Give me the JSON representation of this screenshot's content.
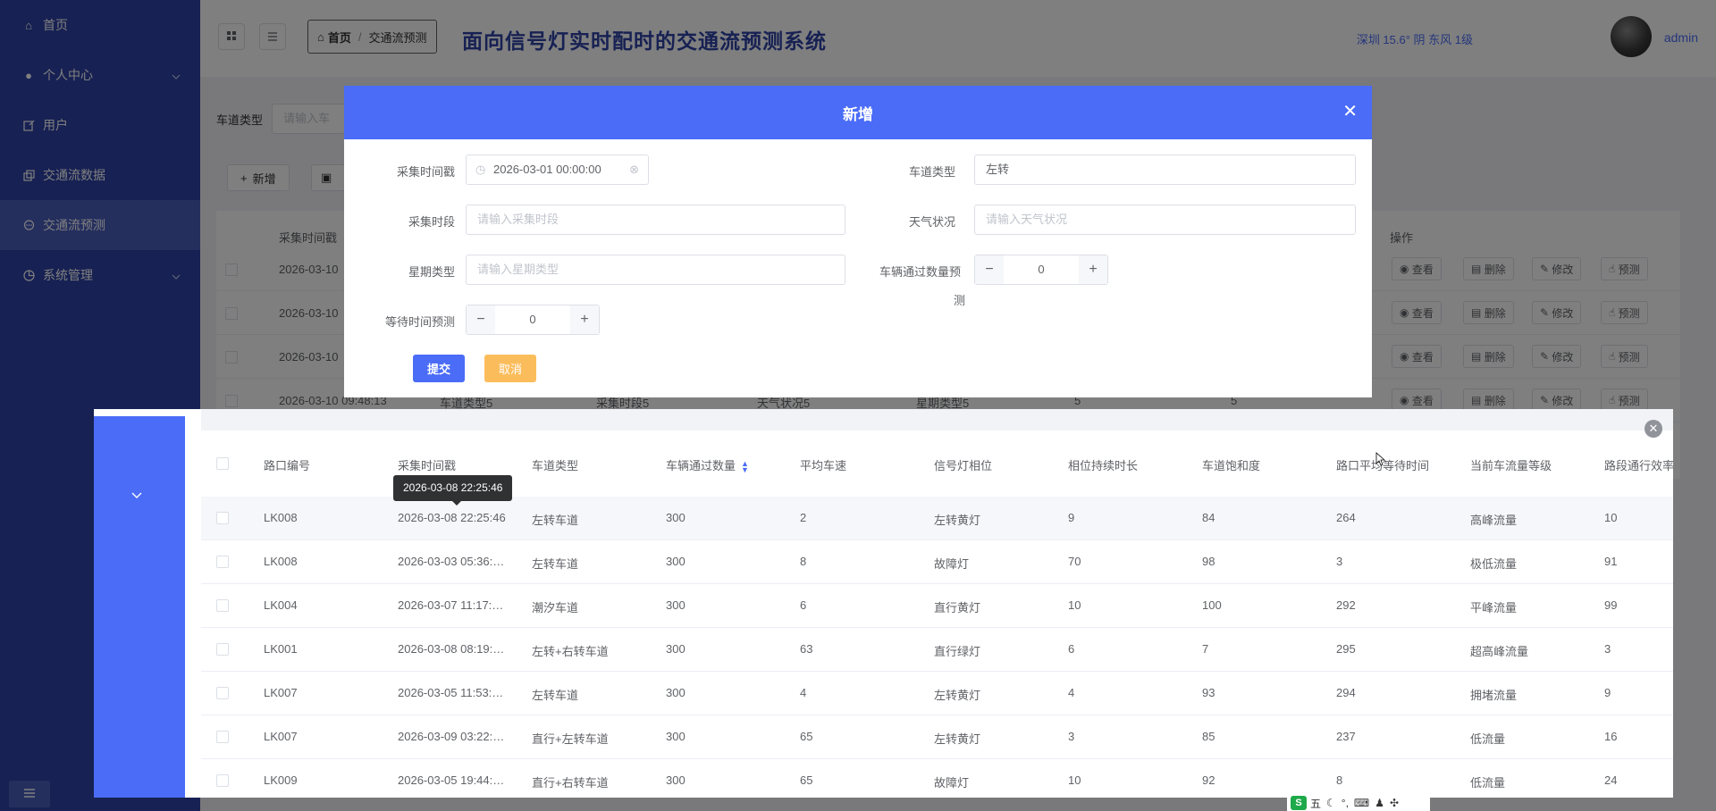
{
  "sidebar": {
    "items": [
      {
        "label": "首页",
        "icon": "home-icon"
      },
      {
        "label": "个人中心",
        "icon": "user-icon"
      },
      {
        "label": "用户",
        "icon": "edit-icon"
      },
      {
        "label": "交通流数据",
        "icon": "copy-icon"
      },
      {
        "label": "交通流预测",
        "icon": "chat-icon",
        "active": true
      },
      {
        "label": "系统管理",
        "icon": "chart-icon"
      }
    ]
  },
  "header": {
    "breadcrumb": {
      "home": "首页",
      "current": "交通流预测"
    },
    "title": "面向信号灯实时配时的交通流预测系统",
    "weather": "深圳 15.6° 阴 东风 1级",
    "user": "admin"
  },
  "main": {
    "search_label": "车道类型",
    "search_placeholder": "请输入车",
    "add_button": "新增",
    "table_headers": {
      "first": "采集时间戳",
      "ops": "操作"
    },
    "rows": [
      "2026-03-10",
      "2026-03-10",
      "2026-03-10",
      "2026-03-10 09:48:13"
    ],
    "row_partial": {
      "lane": "车道类型5",
      "period": "采集时段5",
      "weather": "天气状况5",
      "week": "星期类型5",
      "n1": "5",
      "n2": "5"
    },
    "ops": {
      "view": "查看",
      "delete": "删除",
      "edit": "修改",
      "predict": "预测"
    }
  },
  "dialog": {
    "title": "新增",
    "fields": {
      "timestamp": {
        "label": "采集时间戳",
        "value": "2026-03-01 00:00:00"
      },
      "lane_type": {
        "label": "车道类型",
        "value": "左转"
      },
      "period": {
        "label": "采集时段",
        "placeholder": "请输入采集时段"
      },
      "weather": {
        "label": "天气状况",
        "placeholder": "请输入天气状况"
      },
      "week": {
        "label": "星期类型",
        "placeholder": "请输入星期类型"
      },
      "vehicles": {
        "label_line1": "车辆通过数量预",
        "label_line2": "测",
        "value": "0"
      },
      "wait": {
        "label": "等待时间预测",
        "value": "0"
      }
    },
    "submit": "提交",
    "cancel": "取消"
  },
  "popup": {
    "headers": [
      "路口编号",
      "采集时间戳",
      "车道类型",
      "车辆通过数量",
      "平均车速",
      "信号灯相位",
      "相位持续时长",
      "车道饱和度",
      "路口平均等待时间",
      "当前车流量等级",
      "路段通行效率"
    ],
    "tooltip": "2026-03-08 22:25:46",
    "rows": [
      [
        "LK008",
        "2026-03-08 22:25:46",
        "左转车道",
        "300",
        "2",
        "左转黄灯",
        "9",
        "84",
        "264",
        "高峰流量",
        "10"
      ],
      [
        "LK008",
        "2026-03-03 05:36:…",
        "左转车道",
        "300",
        "8",
        "故障灯",
        "70",
        "98",
        "3",
        "极低流量",
        "91"
      ],
      [
        "LK004",
        "2026-03-07 11:17:…",
        "潮汐车道",
        "300",
        "6",
        "直行黄灯",
        "10",
        "100",
        "292",
        "平峰流量",
        "99"
      ],
      [
        "LK001",
        "2026-03-08 08:19:…",
        "左转+右转车道",
        "300",
        "63",
        "直行绿灯",
        "6",
        "7",
        "295",
        "超高峰流量",
        "3"
      ],
      [
        "LK007",
        "2026-03-05 11:53:…",
        "左转车道",
        "300",
        "4",
        "左转黄灯",
        "4",
        "93",
        "294",
        "拥堵流量",
        "9"
      ],
      [
        "LK007",
        "2026-03-09 03:22:…",
        "直行+左转车道",
        "300",
        "65",
        "左转黄灯",
        "3",
        "85",
        "237",
        "低流量",
        "16"
      ],
      [
        "LK009",
        "2026-03-05 19:44:…",
        "直行+右转车道",
        "300",
        "65",
        "故障灯",
        "10",
        "92",
        "8",
        "低流量",
        "24"
      ]
    ]
  },
  "ime": {
    "label": "五"
  },
  "colors": {
    "sidebar": "#2f43a6",
    "primary": "#4a6cf7",
    "cancel": "#fbbd5c"
  }
}
